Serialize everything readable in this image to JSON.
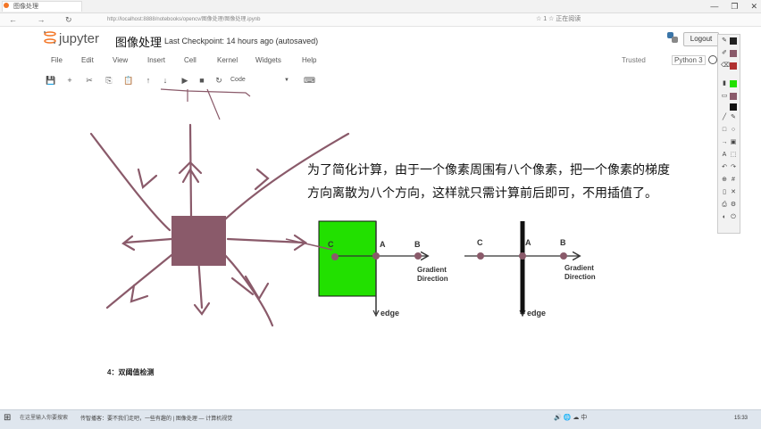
{
  "browser": {
    "tab_title": "图像处理",
    "url": "http://localhost:8888/notebooks/opencv/图像处理/图像处理.ipynb",
    "nav": "← → ↻",
    "tools": "☆ 1  ☆ 正在阅读",
    "window_controls": [
      "—",
      "❐",
      "✕"
    ]
  },
  "header": {
    "logo_text": "jupyter",
    "notebook_name": "图像处理",
    "checkpoint": "Last Checkpoint: 14 hours ago (autosaved)",
    "logout": "Logout"
  },
  "menu": [
    "File",
    "Edit",
    "View",
    "Insert",
    "Cell",
    "Kernel",
    "Widgets",
    "Help"
  ],
  "status": {
    "trusted": "Trusted",
    "kernel": "Python 3"
  },
  "toolbar": {
    "buttons": [
      {
        "name": "save",
        "glyph": "💾"
      },
      {
        "name": "add-cell",
        "glyph": "+"
      },
      {
        "name": "cut",
        "glyph": "✂"
      },
      {
        "name": "copy",
        "glyph": "⎘"
      },
      {
        "name": "paste",
        "glyph": "📋"
      },
      {
        "name": "move-up",
        "glyph": "↑"
      },
      {
        "name": "move-down",
        "glyph": "↓"
      },
      {
        "name": "run",
        "glyph": "▶"
      },
      {
        "name": "interrupt",
        "glyph": "■"
      },
      {
        "name": "restart",
        "glyph": "↻"
      }
    ],
    "cell_type": "Code",
    "keyboard": "⌨"
  },
  "content": {
    "line1": "为了简化计算，由于一个像素周围有八个像素，把一个像素的梯度",
    "line2": "方向离散为八个方向，这样就只需计算前后即可，不用插值了。",
    "diagram_left": {
      "points": [
        "C",
        "A",
        "B"
      ],
      "gradient": [
        "Gradient",
        "Direction"
      ],
      "edge": "edge"
    },
    "diagram_right": {
      "points": [
        "C",
        "A",
        "B"
      ],
      "gradient": [
        "Gradient",
        "Direction"
      ],
      "edge": "edge"
    },
    "section_heading": "4：双阈值检测",
    "colors": {
      "green_block": "#22e000",
      "pixel": "#8a5a6a",
      "annotation": "#8a5a6a"
    }
  },
  "taskbar": {
    "start": "⊞",
    "search": "在这里输入你要搜索",
    "task": "传智播客：要不我们走吧，一些有趣的 | 图像处理 — 计算机视觉",
    "tray": "🔊 🌐 ☁ 中",
    "time": "15:33"
  }
}
